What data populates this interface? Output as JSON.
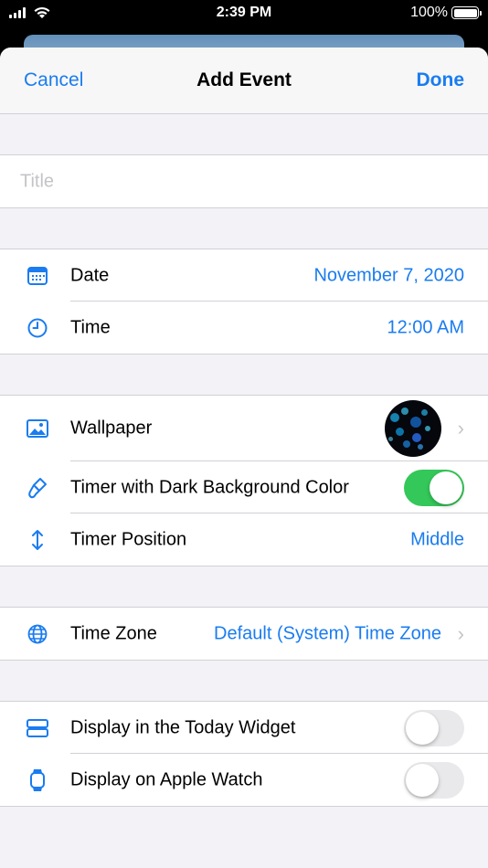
{
  "status_bar": {
    "time": "2:39 PM",
    "battery_percent": "100%"
  },
  "nav": {
    "cancel_label": "Cancel",
    "title": "Add Event",
    "done_label": "Done"
  },
  "title_field": {
    "placeholder": "Title",
    "value": ""
  },
  "date_time": {
    "date_label": "Date",
    "date_value": "November 7, 2020",
    "time_label": "Time",
    "time_value": "12:00 AM"
  },
  "appearance": {
    "wallpaper_label": "Wallpaper",
    "dark_bg_label": "Timer with Dark Background Color",
    "dark_bg_on": true,
    "position_label": "Timer Position",
    "position_value": "Middle"
  },
  "timezone": {
    "label": "Time Zone",
    "value": "Default (System) Time Zone"
  },
  "display": {
    "today_widget_label": "Display in the Today Widget",
    "today_widget_on": false,
    "apple_watch_label": "Display on Apple Watch",
    "apple_watch_on": false
  },
  "colors": {
    "accent": "#1a7cf0",
    "toggle_on": "#34c759",
    "toggle_off": "#e9e9eb",
    "grouped_bg": "#f2f2f7"
  },
  "icons": [
    "calendar-icon",
    "clock-icon",
    "image-icon",
    "paintbrush-icon",
    "up-down-arrows-icon",
    "globe-icon",
    "widget-icon",
    "watch-icon",
    "chevron-right-icon"
  ]
}
